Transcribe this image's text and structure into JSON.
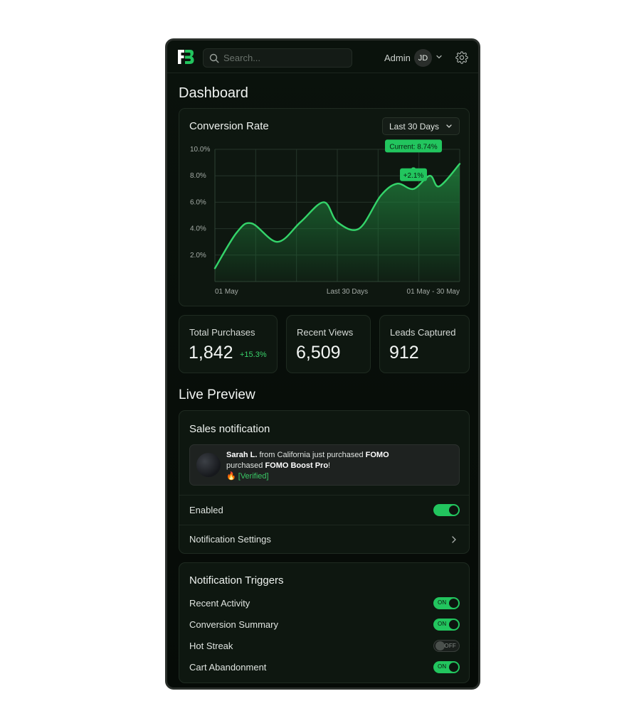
{
  "header": {
    "logo_text": "FB",
    "search_placeholder": "Search...",
    "user_label": "Admin",
    "avatar_initials": "JD"
  },
  "page_title": "Dashboard",
  "chart_card": {
    "title": "Conversion Rate",
    "range_label": "Last 30 Days"
  },
  "chart_data": {
    "type": "area",
    "title": "Conversion Rate",
    "ylim": [
      0,
      10
    ],
    "y_ticks": [
      "10.0%",
      "8.0%",
      "6.0%",
      "4.0%",
      "2.0%"
    ],
    "y_tick_values": [
      10,
      8,
      6,
      4,
      2
    ],
    "x_labels": [
      "01 May",
      "Last 30 Days",
      "01 May - 30 May"
    ],
    "x": [
      0,
      1.6,
      2.7,
      4.6,
      6.3,
      8.0,
      9.0,
      10.6,
      12.2,
      13.4,
      14.6,
      15.8,
      16.5
    ],
    "values": [
      1.0,
      3.7,
      4.4,
      3.0,
      4.5,
      6.0,
      4.5,
      4.0,
      6.5,
      7.4,
      7.0,
      8.0,
      7.2
    ],
    "x_end_value": 8.9,
    "grid": true,
    "annotations": [
      {
        "text": "Current: 8.74%",
        "x": 14.6,
        "y": 8.74
      },
      {
        "text": "+2.1%",
        "x": 14.6,
        "y": 7.0
      }
    ],
    "colors": {
      "line": "#34d46a",
      "fill": "#1f7a3a"
    }
  },
  "stats": [
    {
      "label": "Total Purchases",
      "value": "1,842",
      "delta": "+15.3%"
    },
    {
      "label": "Recent Views",
      "value": "6,509"
    },
    {
      "label": "Leads Captured",
      "value": "912"
    }
  ],
  "live_preview": {
    "title": "Live Preview",
    "card_title": "Sales notification",
    "toast": {
      "name": "Sarah L.",
      "text_1": " from California just purchased ",
      "bold_1": "FOMO",
      "text_2": "purchased ",
      "product": "FOMO Boost Pro",
      "text_3": "!",
      "emoji": "🔥",
      "verified": "[Verified]"
    },
    "enabled_label": "Enabled",
    "enabled": true,
    "settings_label": "Notification Settings"
  },
  "triggers": {
    "title": "Notification Triggers",
    "items": [
      {
        "label": "Recent Activity",
        "state": "ON",
        "on": true
      },
      {
        "label": "Conversion Summary",
        "state": "ON",
        "on": true
      },
      {
        "label": "Hot Streak",
        "state": "OFF",
        "on": false
      },
      {
        "label": "Cart Abandonment",
        "state": "ON",
        "on": true
      }
    ]
  },
  "colors": {
    "accent": "#22c55e",
    "background": "#0a120c",
    "card": "#0e1710"
  }
}
